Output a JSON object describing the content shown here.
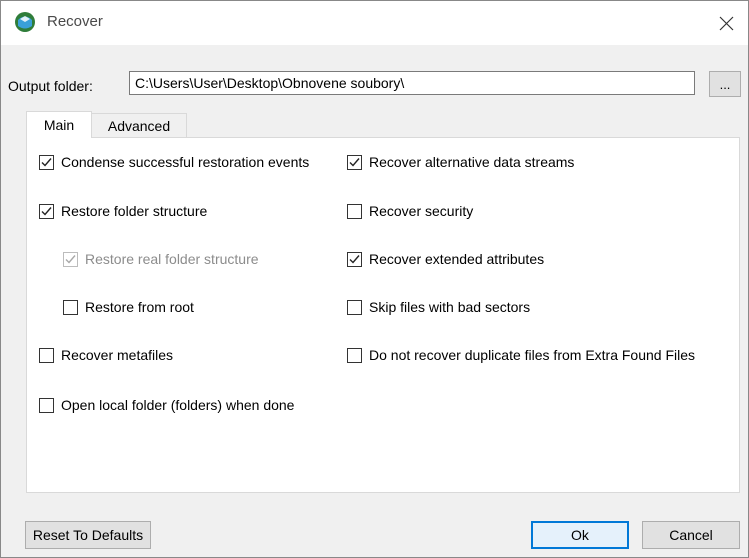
{
  "window": {
    "title": "Recover"
  },
  "output": {
    "label": "Output folder:",
    "path": "C:\\Users\\User\\Desktop\\Obnovene soubory\\",
    "browse_label": "..."
  },
  "tabs": [
    {
      "label": "Main",
      "active": true
    },
    {
      "label": "Advanced",
      "active": false
    }
  ],
  "options_left": [
    {
      "label": "Condense successful restoration events",
      "checked": true,
      "disabled": false
    },
    {
      "label": "Restore folder structure",
      "checked": true,
      "disabled": false
    },
    {
      "label": "Restore real folder structure",
      "checked": true,
      "disabled": true
    },
    {
      "label": "Restore from root",
      "checked": false,
      "disabled": false
    },
    {
      "label": "Recover metafiles",
      "checked": false,
      "disabled": false
    },
    {
      "label": "Open local folder (folders) when done",
      "checked": false,
      "disabled": false
    }
  ],
  "options_right": [
    {
      "label": "Recover alternative data streams",
      "checked": true,
      "disabled": false
    },
    {
      "label": "Recover security",
      "checked": false,
      "disabled": false
    },
    {
      "label": "Recover extended attributes",
      "checked": true,
      "disabled": false
    },
    {
      "label": "Skip files with bad sectors",
      "checked": false,
      "disabled": false
    },
    {
      "label": "Do not recover duplicate files from Extra Found Files",
      "checked": false,
      "disabled": false
    }
  ],
  "buttons": {
    "reset": "Reset To Defaults",
    "ok": "Ok",
    "cancel": "Cancel"
  },
  "icons": {
    "app": "recover-app-icon",
    "close": "close-icon",
    "check": "check-icon"
  },
  "colors": {
    "accent": "#0078d7",
    "window_bg": "#f0f0f0",
    "panel_bg": "#ffffff"
  }
}
